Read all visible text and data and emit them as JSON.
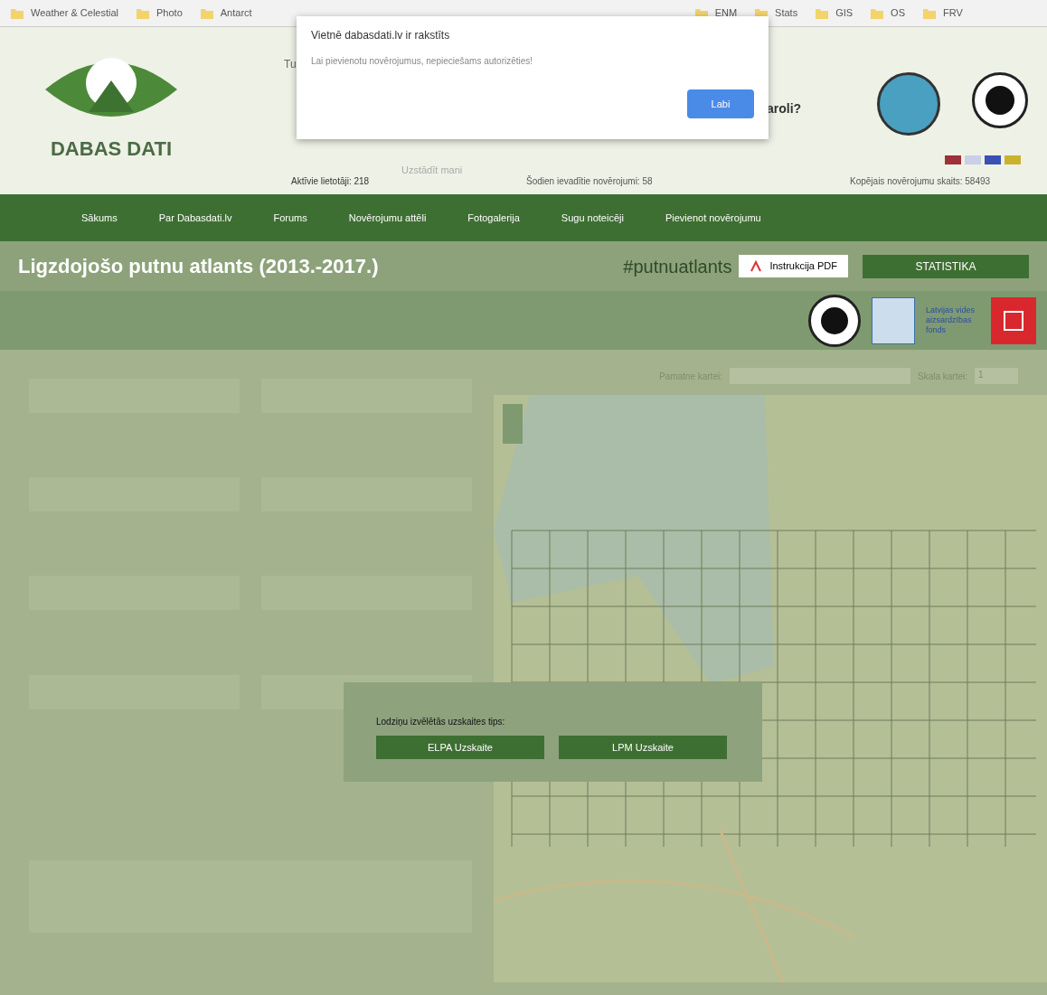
{
  "bookmarks": [
    {
      "label": "Weather & Celestial"
    },
    {
      "label": "Photo"
    },
    {
      "label": "Antarct"
    },
    {
      "label": "ENM"
    },
    {
      "label": "Stats"
    },
    {
      "label": "GIS"
    },
    {
      "label": "OS"
    },
    {
      "label": "FRV"
    }
  ],
  "header": {
    "logo_text": "DABAS DATI",
    "greeting": "Tu",
    "question": "aroli?",
    "active_users": "Aktīvie lietotāji: 218",
    "remember": "Uzstādīt mani",
    "today": "Šodien ievadītie novērojumi: 58",
    "total": "Kopējais novērojumu skaits: 58493"
  },
  "nav": [
    "Sākums",
    "Par Dabasdati.lv",
    "Forums",
    "Novērojumu attēli",
    "Fotogalerija",
    "Sugu noteicēji",
    "Pievienot novērojumu"
  ],
  "title_bar": {
    "title": "Ligzdojošo putnu atlants (2013.-2017.)",
    "hashtag": "#putnuatlants",
    "pdf_button": "Instrukcija PDF",
    "stats_button": "STATISTIKA"
  },
  "partner_text": "Latvijas vides aizsardzības fonds",
  "map": {
    "base_label": "Pamatne kartei:",
    "scale_label": "Skala kartei:",
    "scale_value": "1"
  },
  "modal": {
    "label": "Lodziņu izvēlētās uzskaites tips:",
    "buttons": [
      "ELPA Uzskaite",
      "LPM Uzskaite"
    ]
  },
  "alert": {
    "title": "Vietnē dabasdati.lv ir rakstīts",
    "message": "Lai pievienotu novērojumus, nepieciešams autorizēties!",
    "button": "Labi"
  }
}
